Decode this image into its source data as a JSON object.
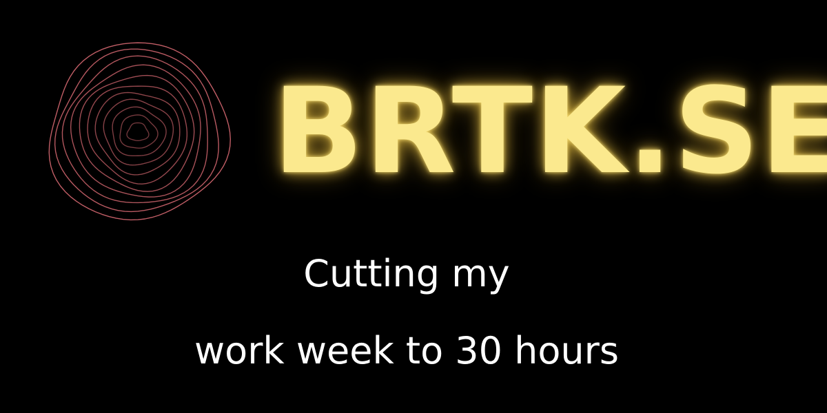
{
  "brand": {
    "title": "BRTK.SE",
    "title_color": "#fbe98e",
    "glow_color": "#ffd24a",
    "logo_icon": "tree-rings-icon",
    "logo_color": "#c9626a"
  },
  "tagline": {
    "line1": "Cutting my",
    "line2": "work week to 30 hours",
    "color": "#ffffff"
  },
  "background_color": "#000000"
}
